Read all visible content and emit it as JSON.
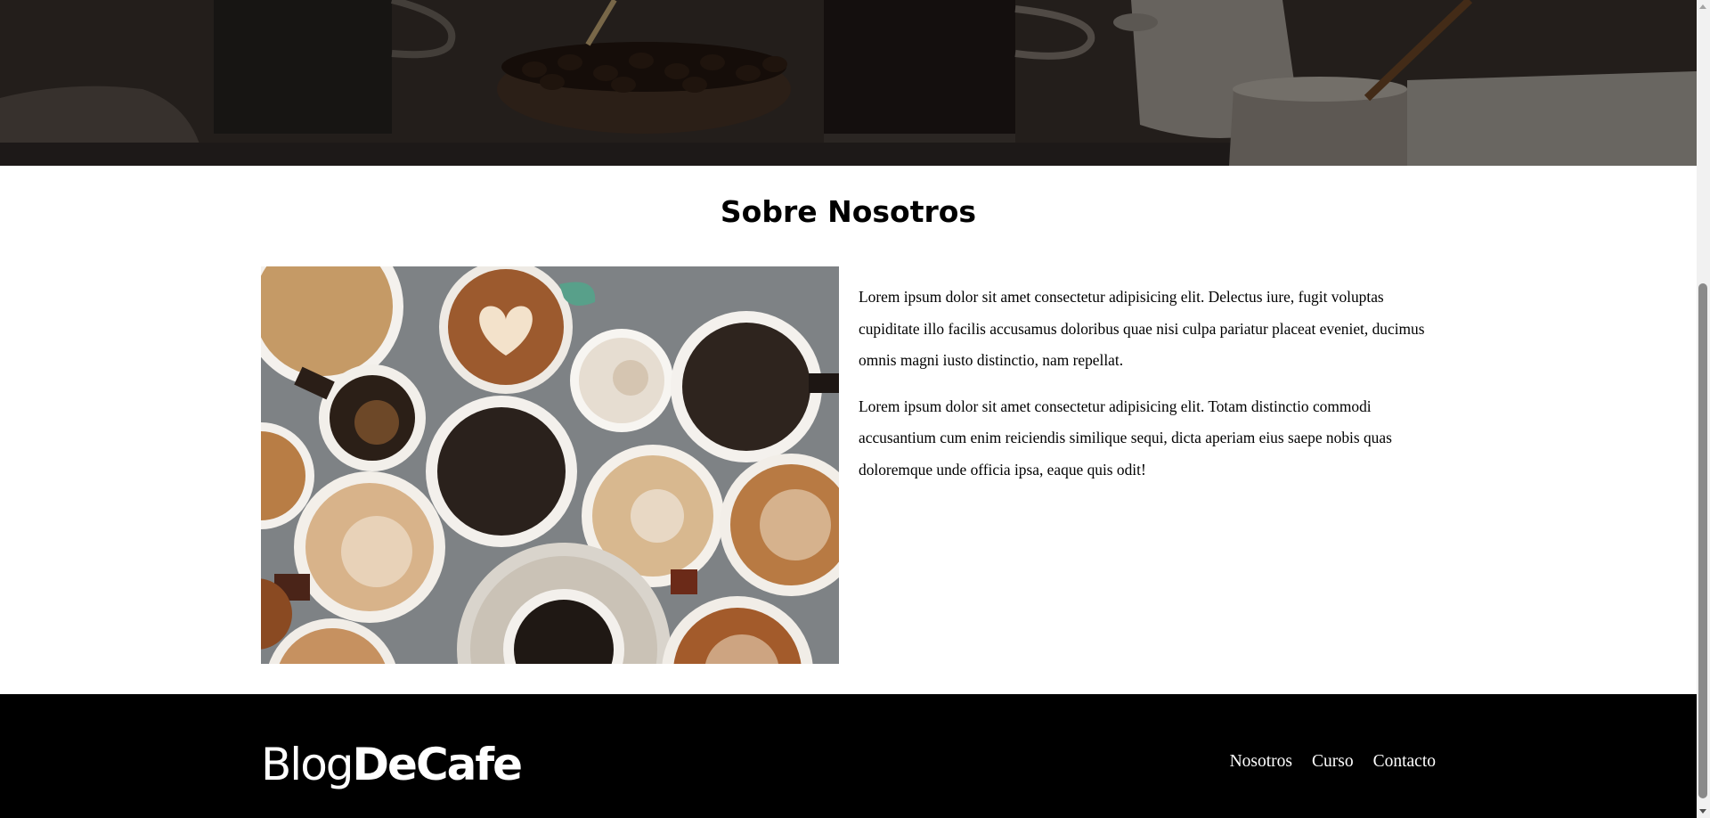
{
  "about": {
    "title": "Sobre Nosotros",
    "image_alt": "Tazas de café vistas desde arriba",
    "paragraphs": [
      "Lorem ipsum dolor sit amet consectetur adipisicing elit. Delectus iure, fugit voluptas cupiditate illo facilis accusamus doloribus quae nisi culpa pariatur placeat eveniet, ducimus omnis magni iusto distinctio, nam repellat.",
      "Lorem ipsum dolor sit amet consectetur adipisicing elit. Totam distinctio commodi accusantium cum enim reiciendis similique sequi, dicta aperiam eius saepe nobis quas doloremque unde officia ipsa, eaque quis odit!"
    ]
  },
  "footer": {
    "logo_light": "Blog",
    "logo_bold": "DeCafe",
    "nav": [
      "Nosotros",
      "Curso",
      "Contacto"
    ]
  },
  "colors": {
    "footer_bg": "#000000",
    "text": "#000000",
    "footer_text": "#ffffff"
  }
}
